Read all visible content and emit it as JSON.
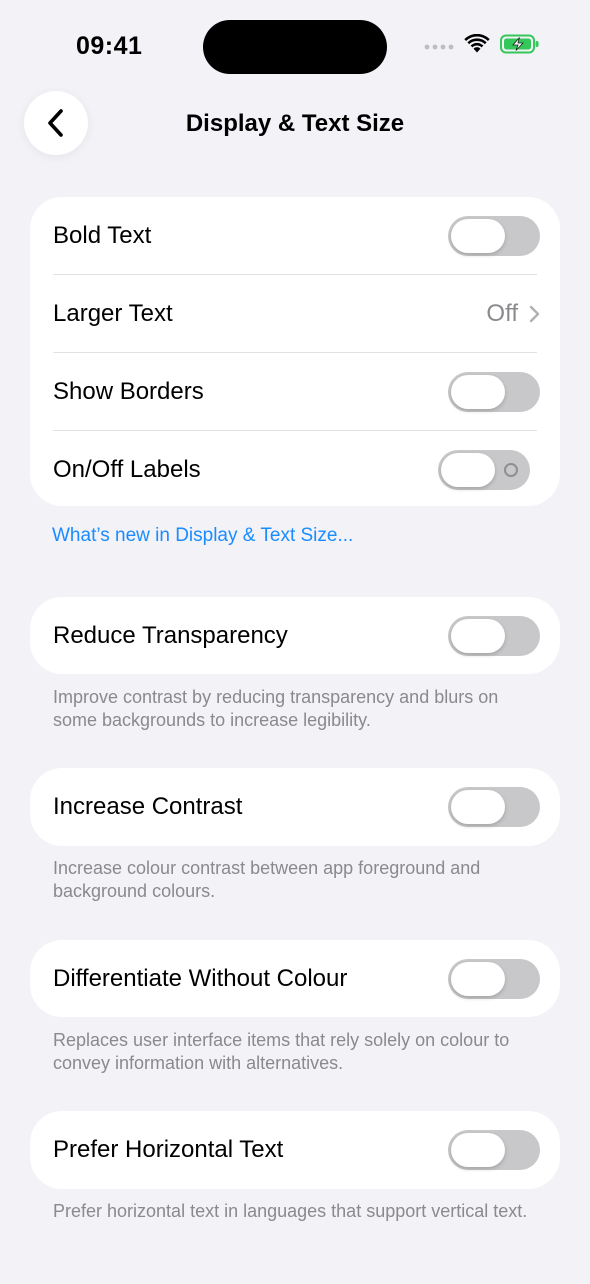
{
  "status_bar": {
    "time": "09:41"
  },
  "header": {
    "title": "Display & Text Size",
    "back_icon": "chevron-left-icon"
  },
  "group1": {
    "rows": [
      {
        "label": "Bold Text",
        "type": "toggle",
        "state": "off"
      },
      {
        "label": "Larger Text",
        "type": "disclosure",
        "value": "Off"
      },
      {
        "label": "Show Borders",
        "type": "toggle",
        "state": "off"
      },
      {
        "label": "On/Off Labels",
        "type": "toggle",
        "state": "off"
      }
    ]
  },
  "link": {
    "label": "What’s new in Display & Text Size..."
  },
  "settings": [
    {
      "label": "Reduce Transparency",
      "state": "off",
      "footnote": "Improve contrast by reducing transparency and blurs on some backgrounds to increase legibility."
    },
    {
      "label": "Increase Contrast",
      "state": "off",
      "footnote": "Increase colour contrast between app foreground and background colours."
    },
    {
      "label": "Differentiate Without Colour",
      "state": "off",
      "footnote": "Replaces user interface items that rely solely on colour to convey information with alternatives."
    },
    {
      "label": "Prefer Horizontal Text",
      "state": "off",
      "footnote": "Prefer horizontal text in languages that support vertical text."
    }
  ],
  "colors": {
    "background": "#F2F2F7",
    "card": "#FFFFFF",
    "toggle_off": "#C8C8CA",
    "link": "#1A8CFF",
    "secondary_text": "#8A8A8E",
    "battery_charging": "#34C759"
  }
}
